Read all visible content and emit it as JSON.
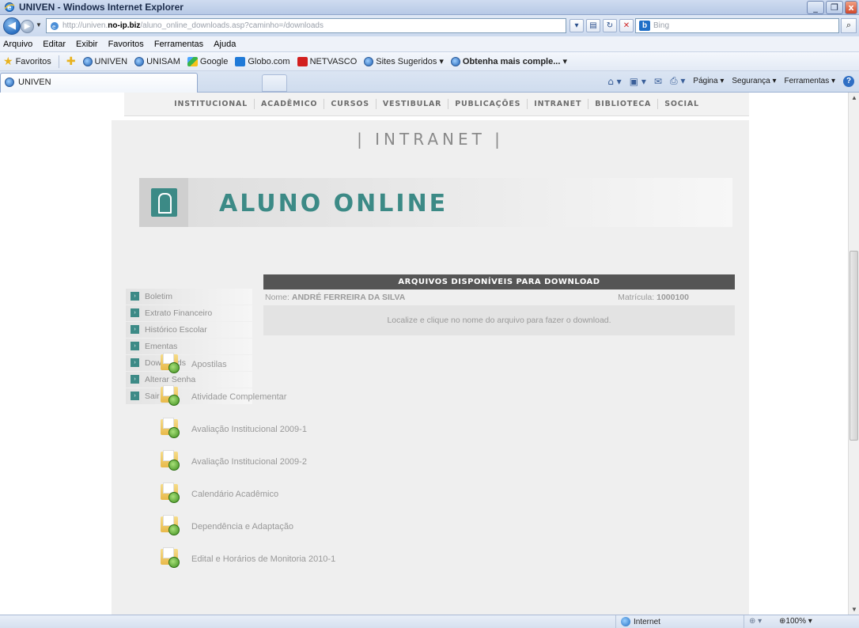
{
  "window": {
    "title": "UNIVEN - Windows Internet Explorer",
    "minimize": "_",
    "restore": "❐",
    "close": "x"
  },
  "address": {
    "url_prefix": "http://univen.",
    "url_host": "no-ip.biz",
    "url_suffix": "/aluno_online_downloads.asp?caminho=/downloads",
    "search_placeholder": "Bing",
    "search_logo": "b"
  },
  "menu": [
    "Arquivo",
    "Editar",
    "Exibir",
    "Favoritos",
    "Ferramentas",
    "Ajuda"
  ],
  "favorites": {
    "label": "Favoritos",
    "items": [
      "UNIVEN",
      "UNISAM",
      "Google",
      "Globo.com",
      "NETVASCO",
      "Sites Sugeridos ▾",
      "Obtenha mais comple... ▾"
    ]
  },
  "tab": {
    "title": "UNIVEN"
  },
  "commandbar": {
    "page": "Página ▾",
    "safety": "Segurança ▾",
    "tools": "Ferramentas ▾",
    "help": "?"
  },
  "site": {
    "nav": [
      "INSTITUCIONAL",
      "ACADÊMICO",
      "CURSOS",
      "VESTIBULAR",
      "PUBLICAÇÕES",
      "INTRANET",
      "BIBLIOTECA",
      "SOCIAL"
    ],
    "section_title": "| INTRANET |",
    "banner_title": "ALUNO ONLINE",
    "sidebar": [
      "Boletim",
      "Extrato Financeiro",
      "Histórico Escolar",
      "Ementas",
      "Downloads",
      "Alterar Senha",
      "Sair"
    ],
    "bullet": "›",
    "panel": {
      "header": "ARQUIVOS DISPONÍVEIS PARA DOWNLOAD",
      "nome_label": "Nome:",
      "nome_value": "ANDRÉ FERREIRA DA SILVA",
      "matricula_label": "Matrícula:",
      "matricula_value": "1000100",
      "hint": "Localize e clique no nome do arquivo para fazer o download."
    },
    "files": [
      "Apostilas",
      "Atividade Complementar",
      "Avaliação Institucional 2009-1",
      "Avaliação Institucional 2009-2",
      "Calendário Acadêmico",
      "Dependência e Adaptação",
      "Edital e Horários de Monitoria 2010-1"
    ]
  },
  "status": {
    "zone": "Internet",
    "protected": "⊕ ▾",
    "zoom": "⊕100% ▾"
  }
}
